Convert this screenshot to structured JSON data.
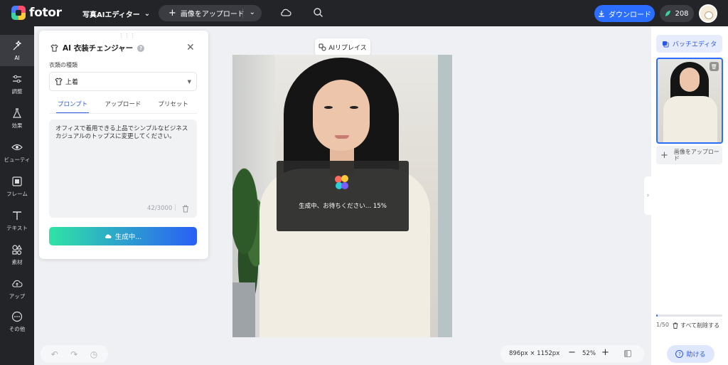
{
  "header": {
    "logo_text": "fotor",
    "editor_menu": "写真AIエディター",
    "upload_label": "画像をアップロード",
    "download_label": "ダウンロード",
    "credits": "208"
  },
  "sidebar": {
    "items": [
      {
        "label": "AI",
        "icon": "ai-sparkle-icon"
      },
      {
        "label": "調整",
        "icon": "adjust-sliders-icon"
      },
      {
        "label": "効果",
        "icon": "effects-flask-icon"
      },
      {
        "label": "ビューティ",
        "icon": "beauty-eye-icon"
      },
      {
        "label": "フレーム",
        "icon": "frame-icon"
      },
      {
        "label": "テキスト",
        "icon": "text-icon"
      },
      {
        "label": "素材",
        "icon": "elements-shapes-icon"
      },
      {
        "label": "アップ",
        "icon": "upload-cloud-icon"
      },
      {
        "label": "その他",
        "icon": "more-icon"
      }
    ]
  },
  "panel": {
    "title": "AI 衣装チェンジャー",
    "clothing_type_label": "衣類の種類",
    "clothing_type_value": "上着",
    "tabs": [
      "プロンプト",
      "アップロード",
      "プリセット"
    ],
    "active_tab": 0,
    "prompt_text": "オフィスで着用できる上品でシンプルなビジネスカジュアルのトップスに変更してください。",
    "char_count": "42/3000",
    "generate_label": "生成中..."
  },
  "canvas": {
    "replace_label": "AIリプレイス",
    "loading_text": "生成中、お待ちください… 15%"
  },
  "bottom": {
    "dimensions": "896px × 1152px",
    "zoom": "52%"
  },
  "rightpanel": {
    "batch_label": "バッチエディタ",
    "add_image_label": "画像をアップロード",
    "count": "1/50",
    "delete_all": "すべて削除する",
    "progress_fraction": 0.02,
    "help_label": "助ける"
  },
  "colors": {
    "accent": "#2b6dff",
    "topbar": "#222428",
    "gradient_start": "#2fe3a5",
    "gradient_end": "#2a5ff5"
  }
}
